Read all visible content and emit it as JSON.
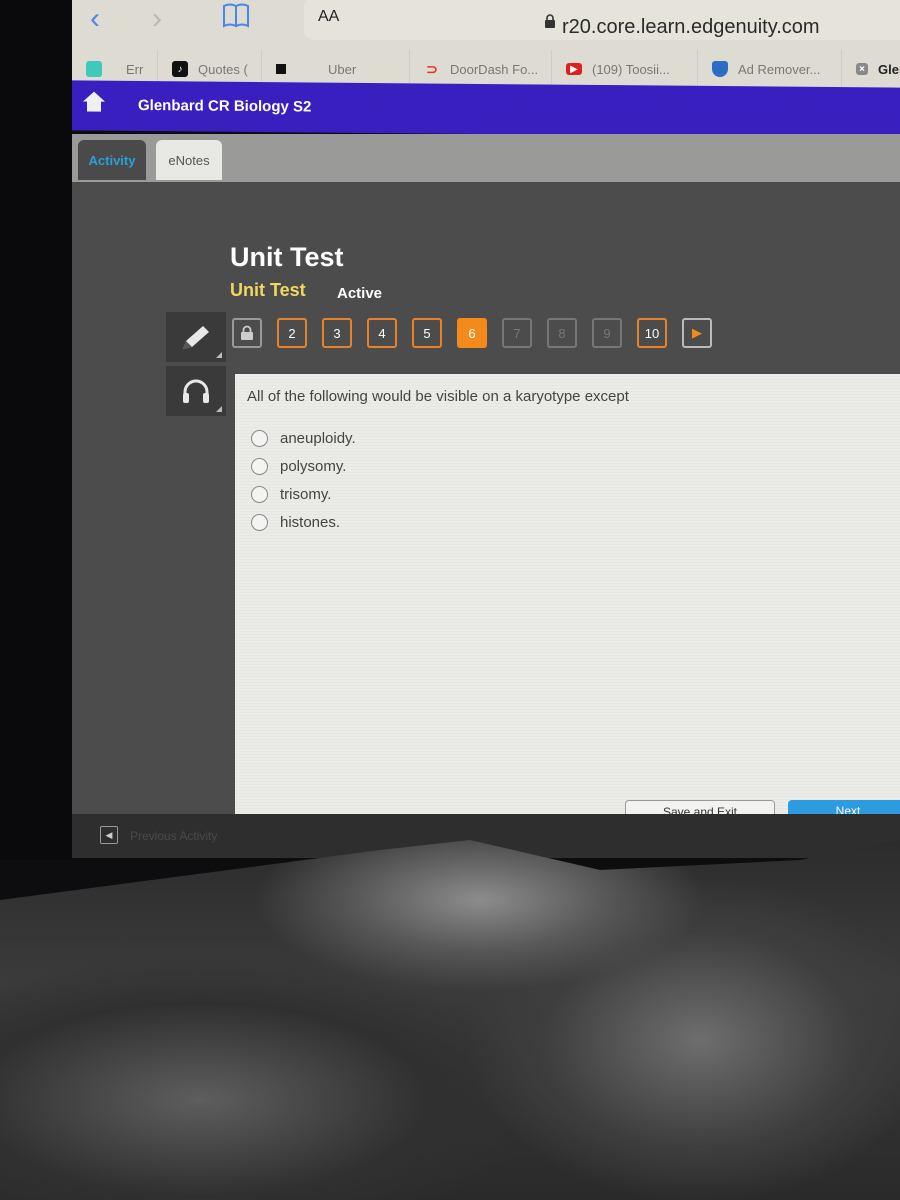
{
  "browser": {
    "address_bar": {
      "text_size_label": "AA",
      "url": "r20.core.learn.edgenuity.com"
    },
    "bookmarks": [
      {
        "label": "Err",
        "icon": "app-icon"
      },
      {
        "label": "Quotes (",
        "icon": "tiktok-icon"
      },
      {
        "label": "Uber",
        "icon": "uber-icon"
      },
      {
        "label": "DoorDash Fo...",
        "icon": "doordash-icon"
      },
      {
        "label": "(109) Toosii...",
        "icon": "youtube-icon"
      },
      {
        "label": "Ad Remover...",
        "icon": "shield-icon"
      },
      {
        "label": "Glenb",
        "icon": "close-box-icon"
      }
    ]
  },
  "app": {
    "course_title": "Glenbard CR Biology S2",
    "tabs": [
      {
        "label": "Activity",
        "active": true
      },
      {
        "label": "eNotes",
        "active": false
      }
    ]
  },
  "activity": {
    "title": "Unit Test",
    "subtitle": "Unit Test",
    "status": "Active",
    "question_nav": [
      {
        "label": "",
        "state": "locked"
      },
      {
        "label": "2",
        "state": "answered"
      },
      {
        "label": "3",
        "state": "answered"
      },
      {
        "label": "4",
        "state": "answered"
      },
      {
        "label": "5",
        "state": "answered"
      },
      {
        "label": "6",
        "state": "current"
      },
      {
        "label": "7",
        "state": "disabled"
      },
      {
        "label": "8",
        "state": "disabled"
      },
      {
        "label": "9",
        "state": "disabled"
      },
      {
        "label": "10",
        "state": "answered"
      }
    ],
    "question": {
      "prompt": "All of the following would be visible on a karyotype except",
      "choices": [
        "aneuploidy.",
        "polysomy.",
        "trisomy.",
        "histones."
      ]
    },
    "buttons": {
      "save_exit": "Save and Exit",
      "next": "Next"
    }
  },
  "footer": {
    "previous_activity": "Previous Activity"
  }
}
